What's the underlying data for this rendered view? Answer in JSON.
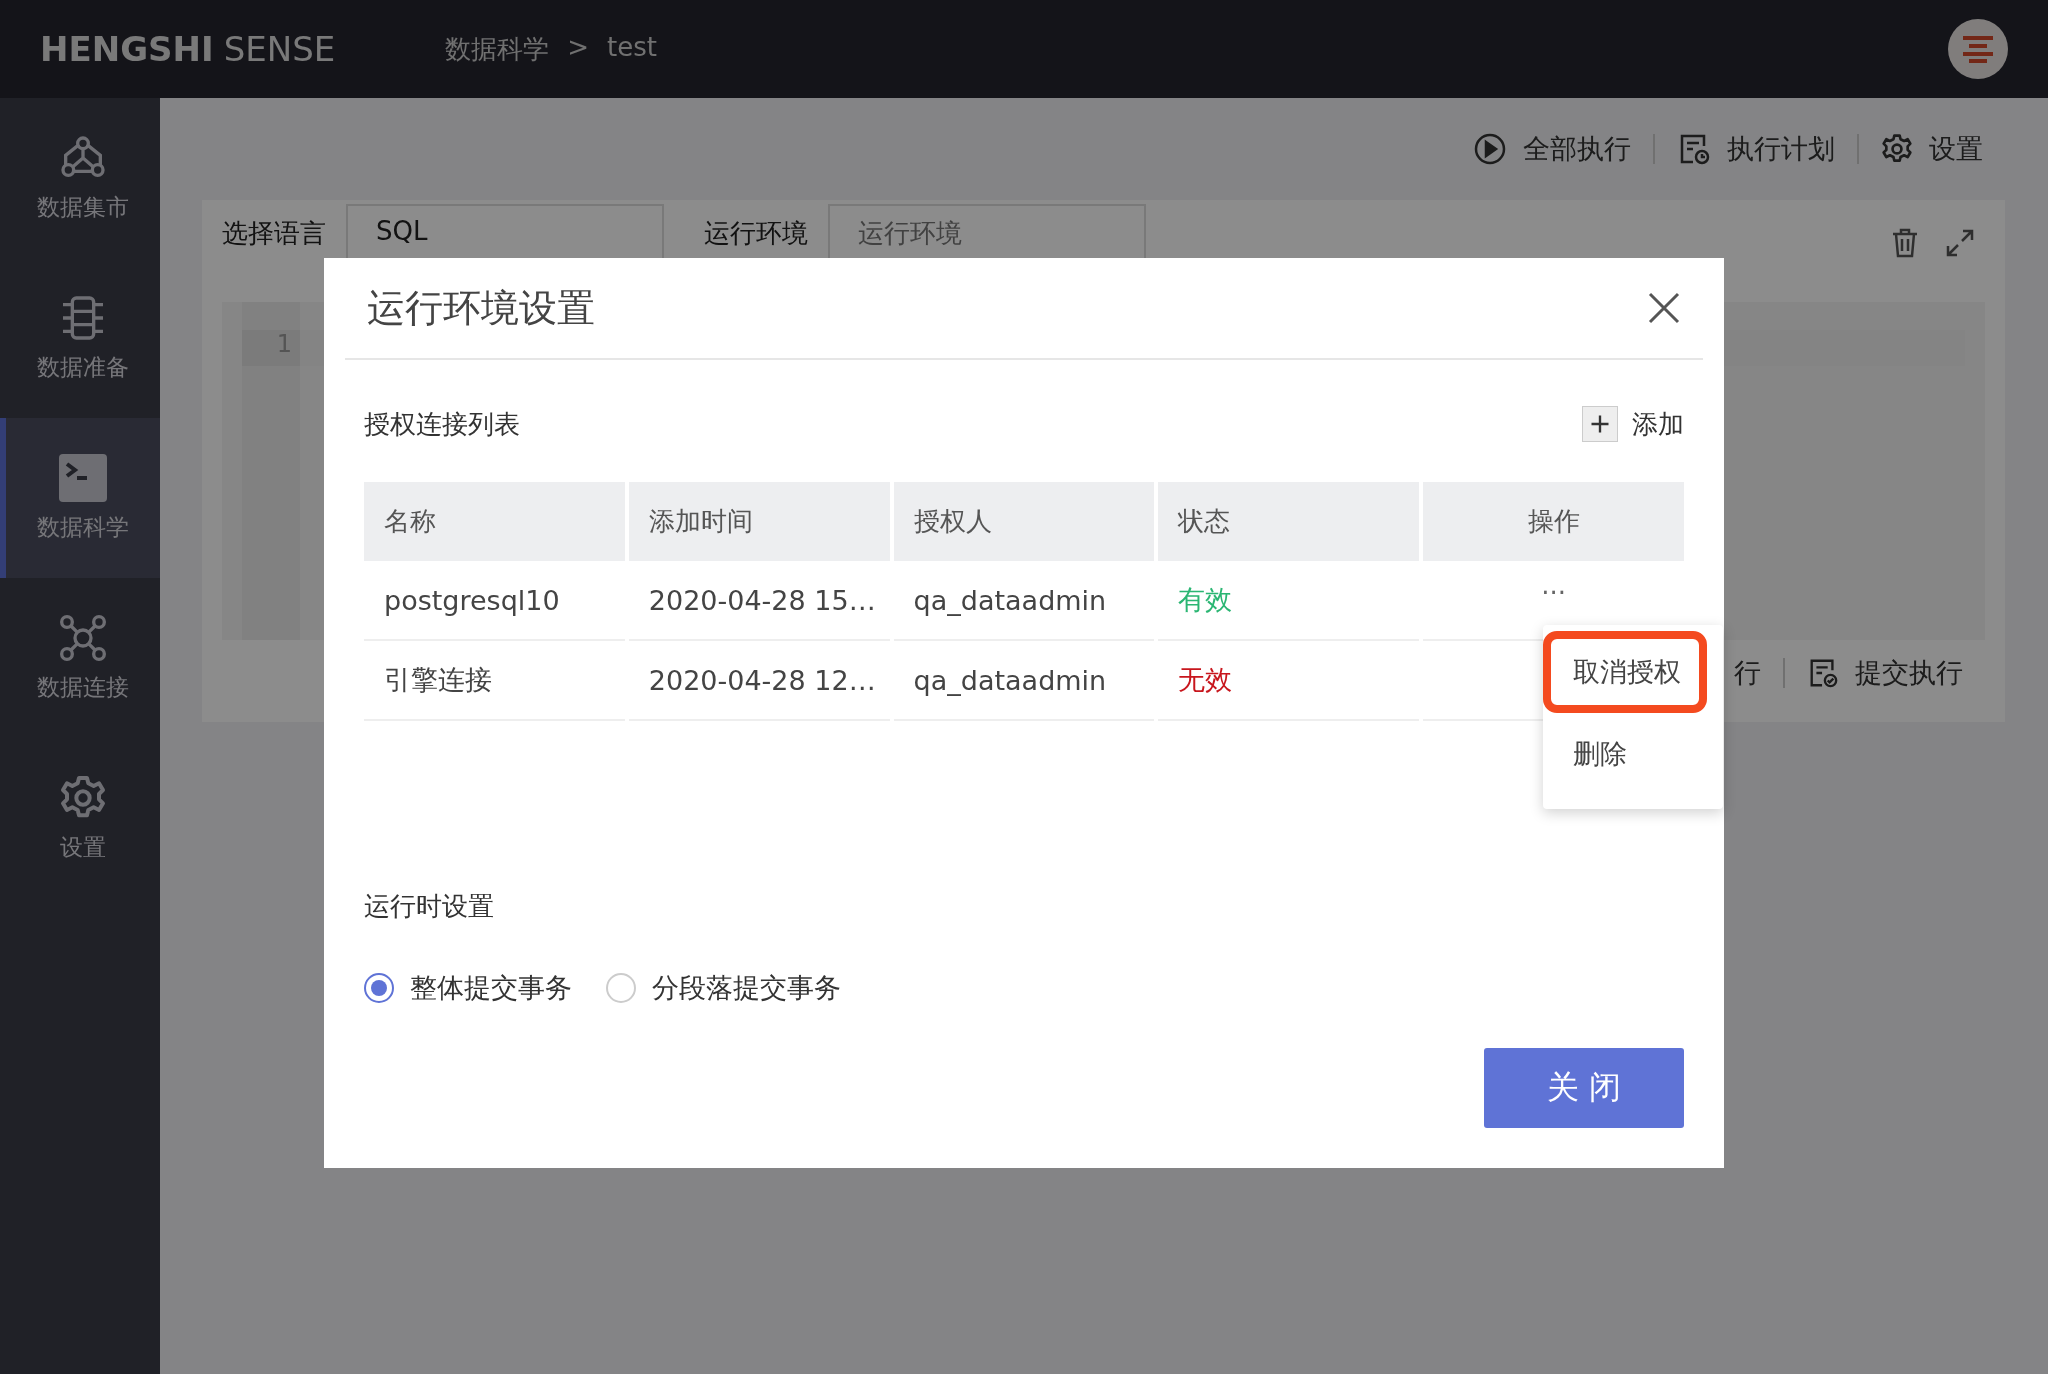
{
  "topbar": {
    "logo_bold": "HENGSHI",
    "logo_light": "SENSE",
    "breadcrumb": [
      {
        "label": "数据科学"
      },
      {
        "label": "test"
      }
    ],
    "breadcrumb_separator": ">"
  },
  "sidebar": {
    "items": [
      {
        "label": "数据集市",
        "selected": false
      },
      {
        "label": "数据准备",
        "selected": false
      },
      {
        "label": "数据科学",
        "selected": true
      },
      {
        "label": "数据连接",
        "selected": false
      },
      {
        "label": "设置",
        "selected": false
      }
    ]
  },
  "toolbar": [
    {
      "label": "全部执行"
    },
    {
      "label": "执行计划"
    },
    {
      "label": "设置"
    }
  ],
  "editor": {
    "language_label": "选择语言",
    "language_value": "SQL",
    "env_label": "运行环境",
    "env_placeholder": "运行环境",
    "line_numbers": [
      "1"
    ],
    "footer_buttons": [
      {
        "label": "行"
      },
      {
        "label": "提交执行"
      }
    ]
  },
  "dialog": {
    "title": "运行环境设置",
    "section_title": "授权连接列表",
    "add_label": "添加",
    "table": {
      "columns": [
        "名称",
        "添加时间",
        "授权人",
        "状态",
        "操作"
      ],
      "rows": [
        {
          "name": "postgresql10",
          "added": "2020-04-28 15…",
          "owner": "qa_dataadmin",
          "status": "有效",
          "valid": true,
          "actions": "···"
        },
        {
          "name": "引擎连接",
          "added": "2020-04-28 12…",
          "owner": "qa_dataadmin",
          "status": "无效",
          "valid": false
        }
      ]
    },
    "menu": {
      "items": [
        {
          "label": "取消授权",
          "highlighted": true
        },
        {
          "label": "删除",
          "highlighted": false
        }
      ]
    },
    "runtime_title": "运行时设置",
    "commit_modes": [
      {
        "label": "整体提交事务",
        "selected": true
      },
      {
        "label": "分段落提交事务",
        "selected": false
      }
    ],
    "close_button": "关 闭"
  }
}
